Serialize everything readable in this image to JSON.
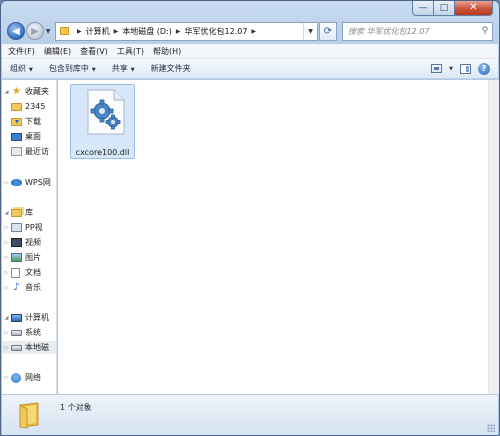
{
  "window": {
    "controls": {
      "minimize": "—",
      "maximize": "□",
      "close": "✕"
    }
  },
  "address_bar": {
    "breadcrumbs": [
      "计算机",
      "本地磁盘 (D:)",
      "华军优化包12.07"
    ],
    "search_placeholder": "搜索 华军优化包12.07"
  },
  "menu": [
    "文件(F)",
    "编辑(E)",
    "查看(V)",
    "工具(T)",
    "帮助(H)"
  ],
  "toolbar": {
    "organize": "组织",
    "include_in_library": "包含到库中",
    "share": "共享",
    "new_folder": "新建文件夹"
  },
  "nav_pane": {
    "favorites": "收藏夹",
    "fav_2345": "2345",
    "downloads": "下载",
    "desktop": "桌面",
    "recent": "最近访",
    "wps": "WPS网",
    "libraries": "库",
    "pp": "PP视",
    "videos": "视频",
    "pictures": "图片",
    "documents": "文档",
    "music": "音乐",
    "computer": "计算机",
    "system": "系统",
    "local_disk": "本地磁",
    "network": "网络"
  },
  "files": [
    {
      "name": "cxcore100.dll",
      "icon": "dll-gear-icon"
    }
  ],
  "status": {
    "count": "1 个对象"
  },
  "colors": {
    "accent": "#2f6fc2",
    "selection": "#d7e8fb",
    "close": "#c8543b"
  }
}
